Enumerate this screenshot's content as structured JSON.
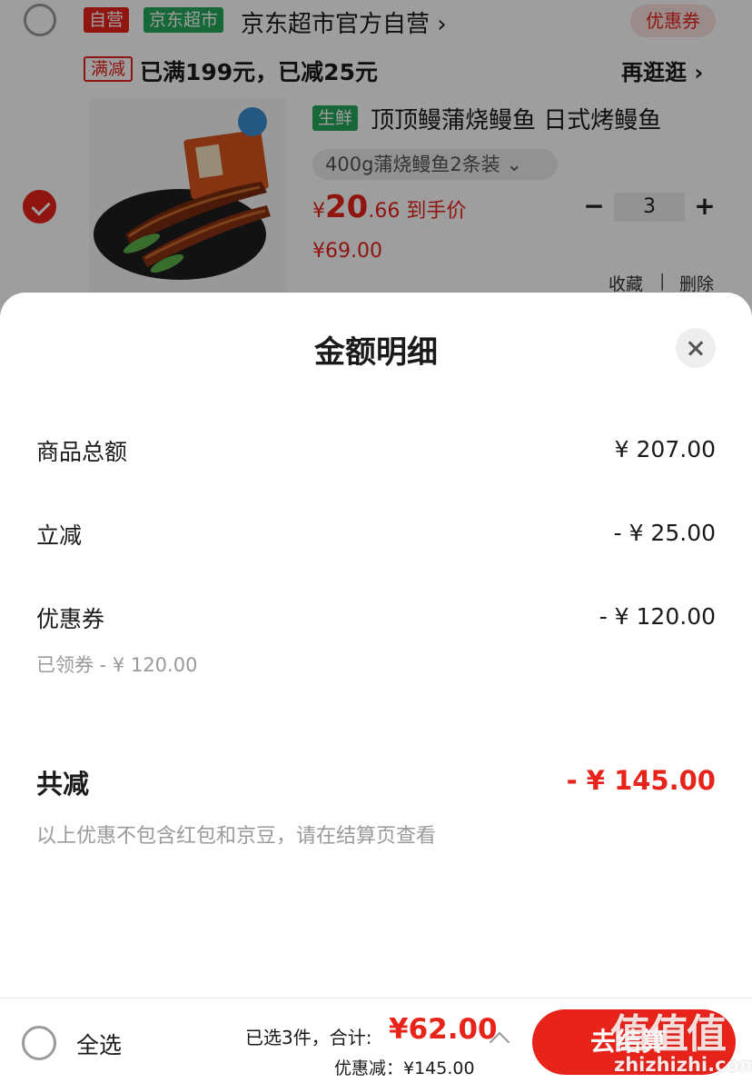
{
  "cart": {
    "shop": {
      "tag_self": "自营",
      "tag_market": "京东超市",
      "name": "京东超市官方自营 ›",
      "coupon_label": "优惠券"
    },
    "promo": {
      "tag": "满减",
      "text": "已满199元，已减25元",
      "more_label": "再逛逛 ›"
    },
    "product": {
      "tag": "生鲜",
      "title": "顶顶鳗蒲烧鳗鱼 日式烤鳗鱼",
      "sku": "400g蒲烧鳗鱼2条装 ⌄",
      "price_symbol": "¥",
      "price_int": "20",
      "price_dec": ".66",
      "price_suffix": " 到手价",
      "original_price": "¥69.00",
      "quantity": "3",
      "minus": "−",
      "plus": "+",
      "favorite_label": "收藏",
      "separator": "|",
      "delete_label": "删除",
      "selected": true
    }
  },
  "sheet": {
    "title": "金额明细",
    "rows": [
      {
        "label": "商品总额",
        "value": "¥ 207.00"
      },
      {
        "label": "立减",
        "value": "- ¥ 25.00"
      },
      {
        "label": "优惠券",
        "value": "- ¥ 120.00",
        "sub": "已领券 - ¥ 120.00"
      }
    ],
    "total_label": "共减",
    "total_value": "- ¥ 145.00",
    "note": "以上优惠不包含红包和京豆，请在结算页查看"
  },
  "bottom_bar": {
    "select_all_label": "全选",
    "selected_text": "已选3件，合计:",
    "total": "¥62.00",
    "discount_text": "优惠减：¥145.00",
    "checkout_label": "去结算"
  },
  "watermark": {
    "logo": "值值值",
    "url": "zhizhizhi.com"
  },
  "colors": {
    "accent": "#e8231a",
    "green_tag": "#25a85b",
    "muted_text": "#9a9a9a"
  }
}
